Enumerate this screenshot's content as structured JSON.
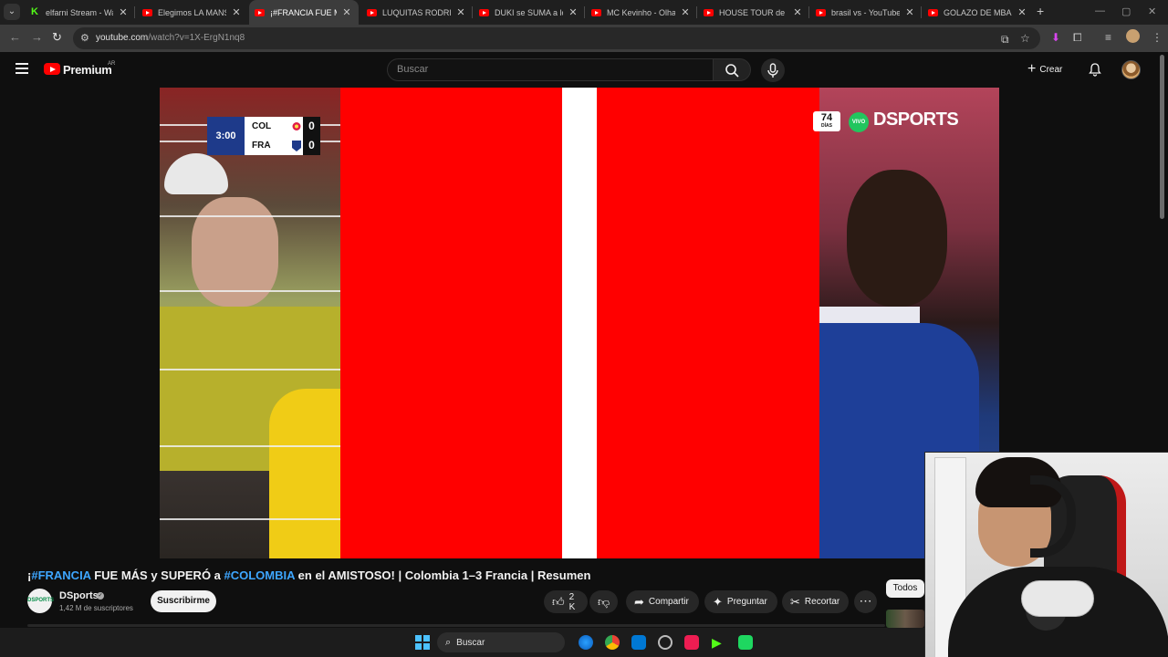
{
  "browser": {
    "tabs": [
      {
        "title": "elfarni Stream - Watc",
        "icon": "kick-icon",
        "active": false
      },
      {
        "title": "Elegimos LA MANSIÓ",
        "icon": "youtube-icon",
        "active": false
      },
      {
        "title": "¡#FRANCIA FUE MÁS",
        "icon": "youtube-icon",
        "active": true
      },
      {
        "title": "LUQUITAS RODRIGUE",
        "icon": "youtube-icon",
        "active": false
      },
      {
        "title": "DUKI se SUMA a los T",
        "icon": "youtube-icon",
        "active": false
      },
      {
        "title": "MC Kevinho - Olha a",
        "icon": "youtube-icon",
        "active": false
      },
      {
        "title": "HOUSE TOUR de mi f",
        "icon": "youtube-icon",
        "active": false
      },
      {
        "title": "brasil vs - YouTube",
        "icon": "youtube-icon",
        "active": false
      },
      {
        "title": "GOLAZO DE MBAPPE",
        "icon": "youtube-icon",
        "active": false
      }
    ],
    "url_host": "youtube.com",
    "url_path": "/watch?v=1X-ErgN1nq8"
  },
  "youtube": {
    "brand": "Premium",
    "country": "AR",
    "search_placeholder": "Buscar",
    "create_label": "Crear"
  },
  "video": {
    "scoreboard": {
      "time": "3:00",
      "home_team": "COL",
      "home_score": "0",
      "away_team": "FRA",
      "away_score": "0"
    },
    "broadcaster": "DSPORTS",
    "live_label": "VIVO",
    "days_badge": "74",
    "days_label": "DÍAS"
  },
  "meta": {
    "title_prefix": "¡",
    "title_tag1": "#FRANCIA",
    "title_mid": " FUE MÁS y SUPERÓ a ",
    "title_tag2": "#COLOMBIA",
    "title_rest": " en el AMISTOSO! | Colombia 1–3 Francia | Resumen",
    "channel_name": "DSports",
    "channel_avatar_text": "DSPORTS",
    "subscribers": "1,42 M de suscriptores",
    "subscribe_label": "Suscribirme",
    "likes": "2 K",
    "share_label": "Compartir",
    "ask_label": "Preguntar",
    "clip_label": "Recortar",
    "filter_chip": "Todos"
  },
  "taskbar": {
    "search_label": "Buscar"
  }
}
